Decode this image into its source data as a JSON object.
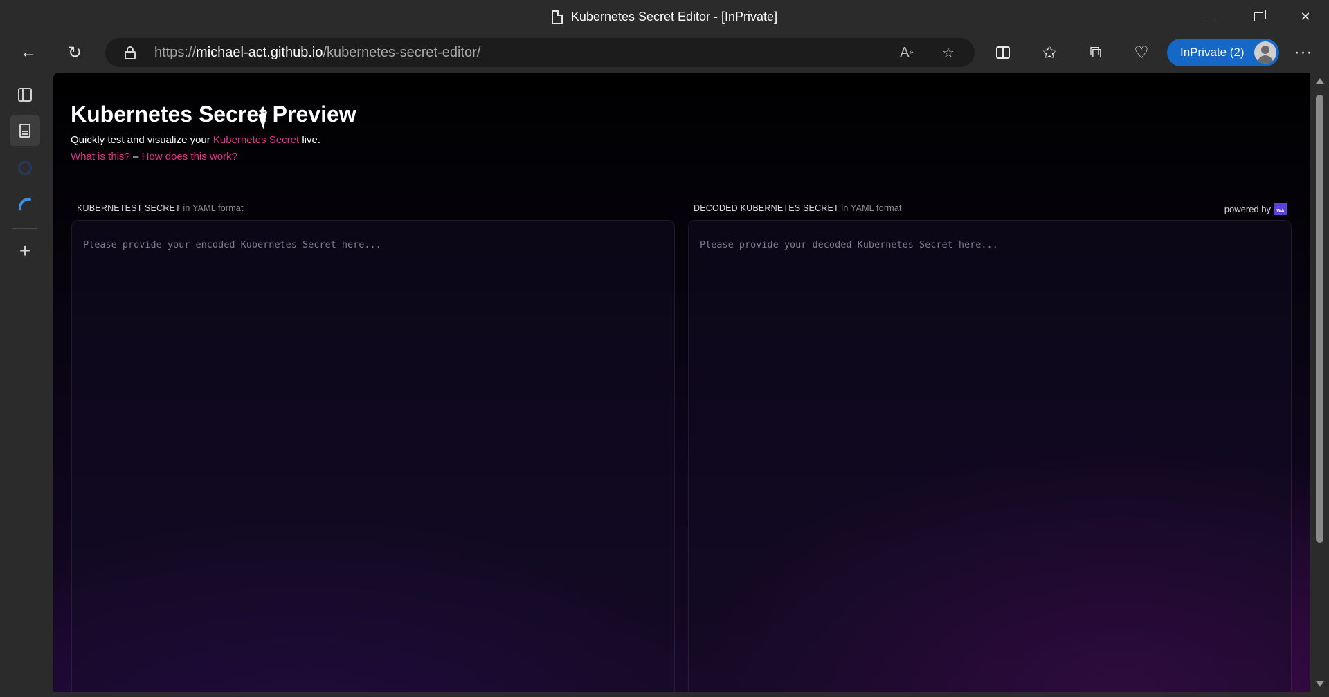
{
  "window": {
    "title": "Kubernetes Secret Editor - [InPrivate]"
  },
  "browser": {
    "url_prefix": "https://",
    "url_host": "michael-act.github.io",
    "url_path": "/kubernetes-secret-editor/",
    "profile_label": "InPrivate (2)",
    "icons": [
      "back-icon",
      "refresh-icon",
      "lock-icon",
      "read-aloud-icon",
      "favorite-star-icon",
      "split-screen-icon",
      "favorites-icon",
      "collections-icon",
      "browser-essentials-icon",
      "more-icon"
    ]
  },
  "page": {
    "title": "Kubernetes Secret Preview",
    "subtitle_prefix": "Quickly test and visualize your ",
    "subtitle_link": "Kubernetes Secret",
    "subtitle_suffix": " live.",
    "link_what": "What is this?",
    "link_sep": " – ",
    "link_how": "How does this work?"
  },
  "encoded_panel": {
    "label": "KUBERNETEST SECRET",
    "format": " in YAML format",
    "placeholder": "Please provide your encoded Kubernetes Secret here..."
  },
  "decoded_panel": {
    "label": "DECODED KUBERNETES SECRET",
    "format": " in YAML format",
    "placeholder": "Please provide your decoded Kubernetes Secret here...",
    "powered_by": "powered by",
    "logo_text": "WA"
  },
  "colors": {
    "accent_link": "#e0338a",
    "inprivate_blue": "#1668c7",
    "page_background": "#000000"
  }
}
